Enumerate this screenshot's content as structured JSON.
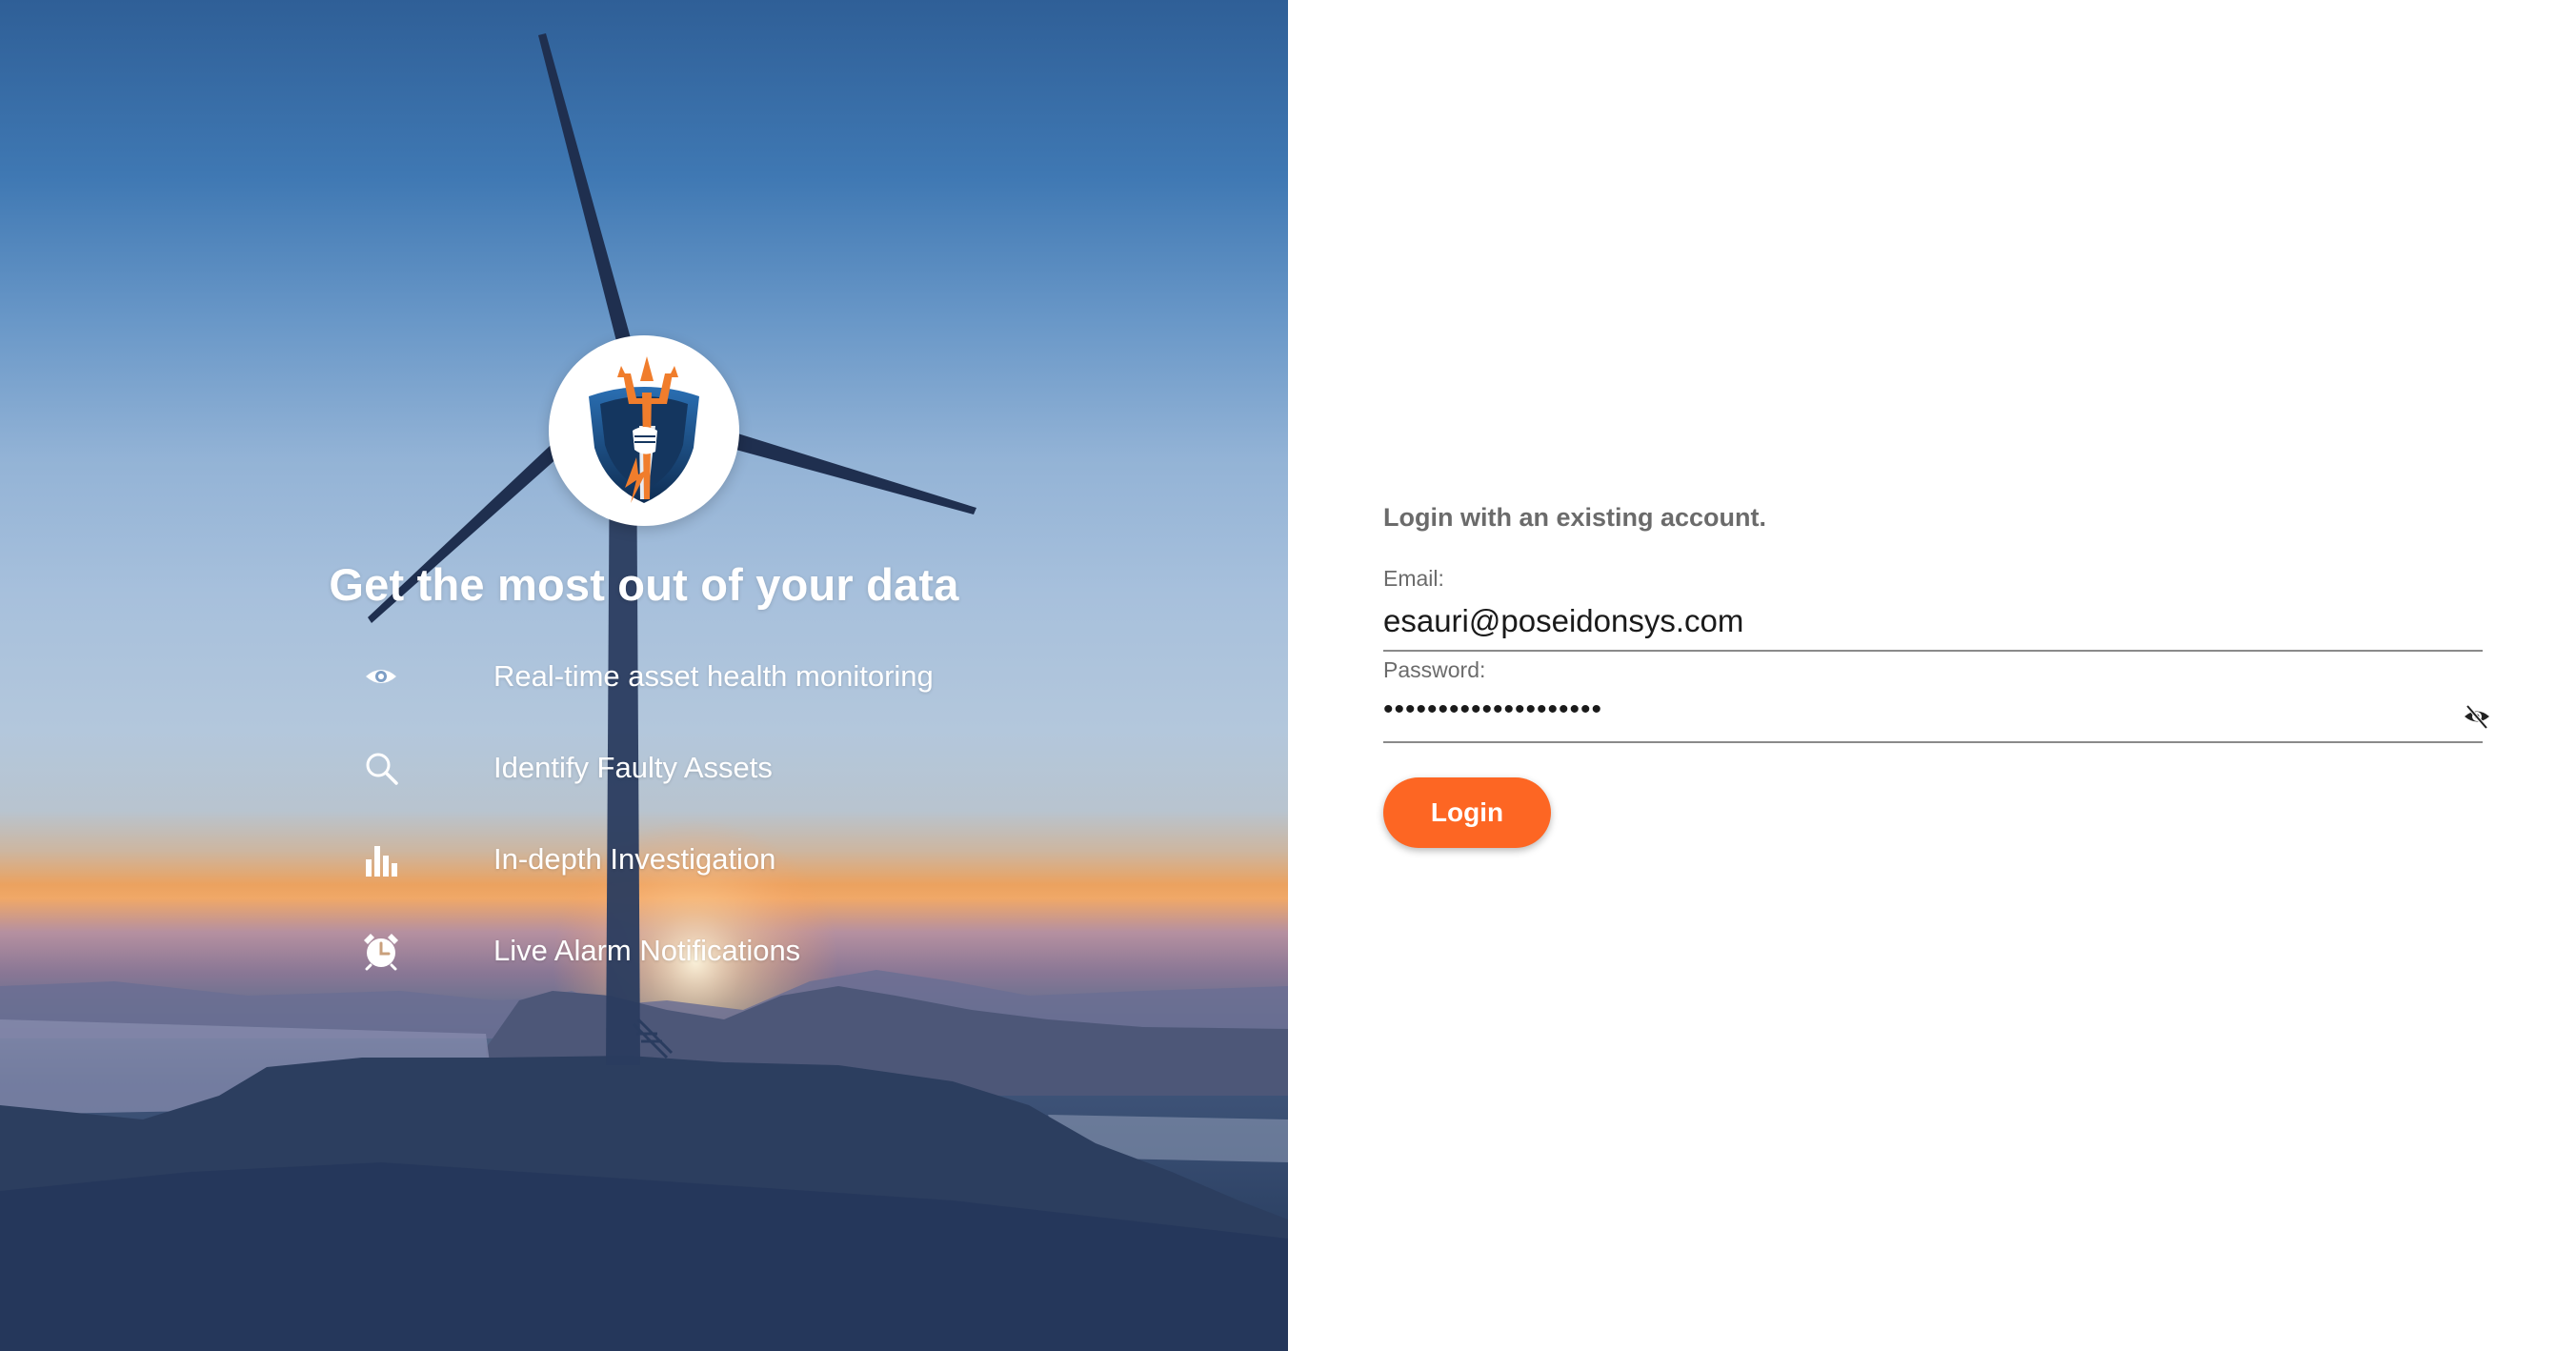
{
  "hero": {
    "title": "Get the most out of your data",
    "features": [
      {
        "icon": "eye-icon",
        "label": "Real-time asset health monitoring"
      },
      {
        "icon": "search-icon",
        "label": "Identify Faulty Assets"
      },
      {
        "icon": "bar-chart-icon",
        "label": "In-depth Investigation"
      },
      {
        "icon": "alarm-clock-icon",
        "label": "Live Alarm Notifications"
      }
    ],
    "logo": "trident-shield-logo"
  },
  "login": {
    "heading": "Login with an existing account.",
    "email_label": "Email:",
    "email_value": "esauri@poseidonsys.com",
    "password_label": "Password:",
    "password_value": "••••••••••••••••••••",
    "toggle_icon": "eye-slash-icon",
    "login_label": "Login"
  },
  "colors": {
    "accent": "#fd6623",
    "text_muted": "#6b6b6b",
    "text_primary": "#1a1a1a"
  }
}
